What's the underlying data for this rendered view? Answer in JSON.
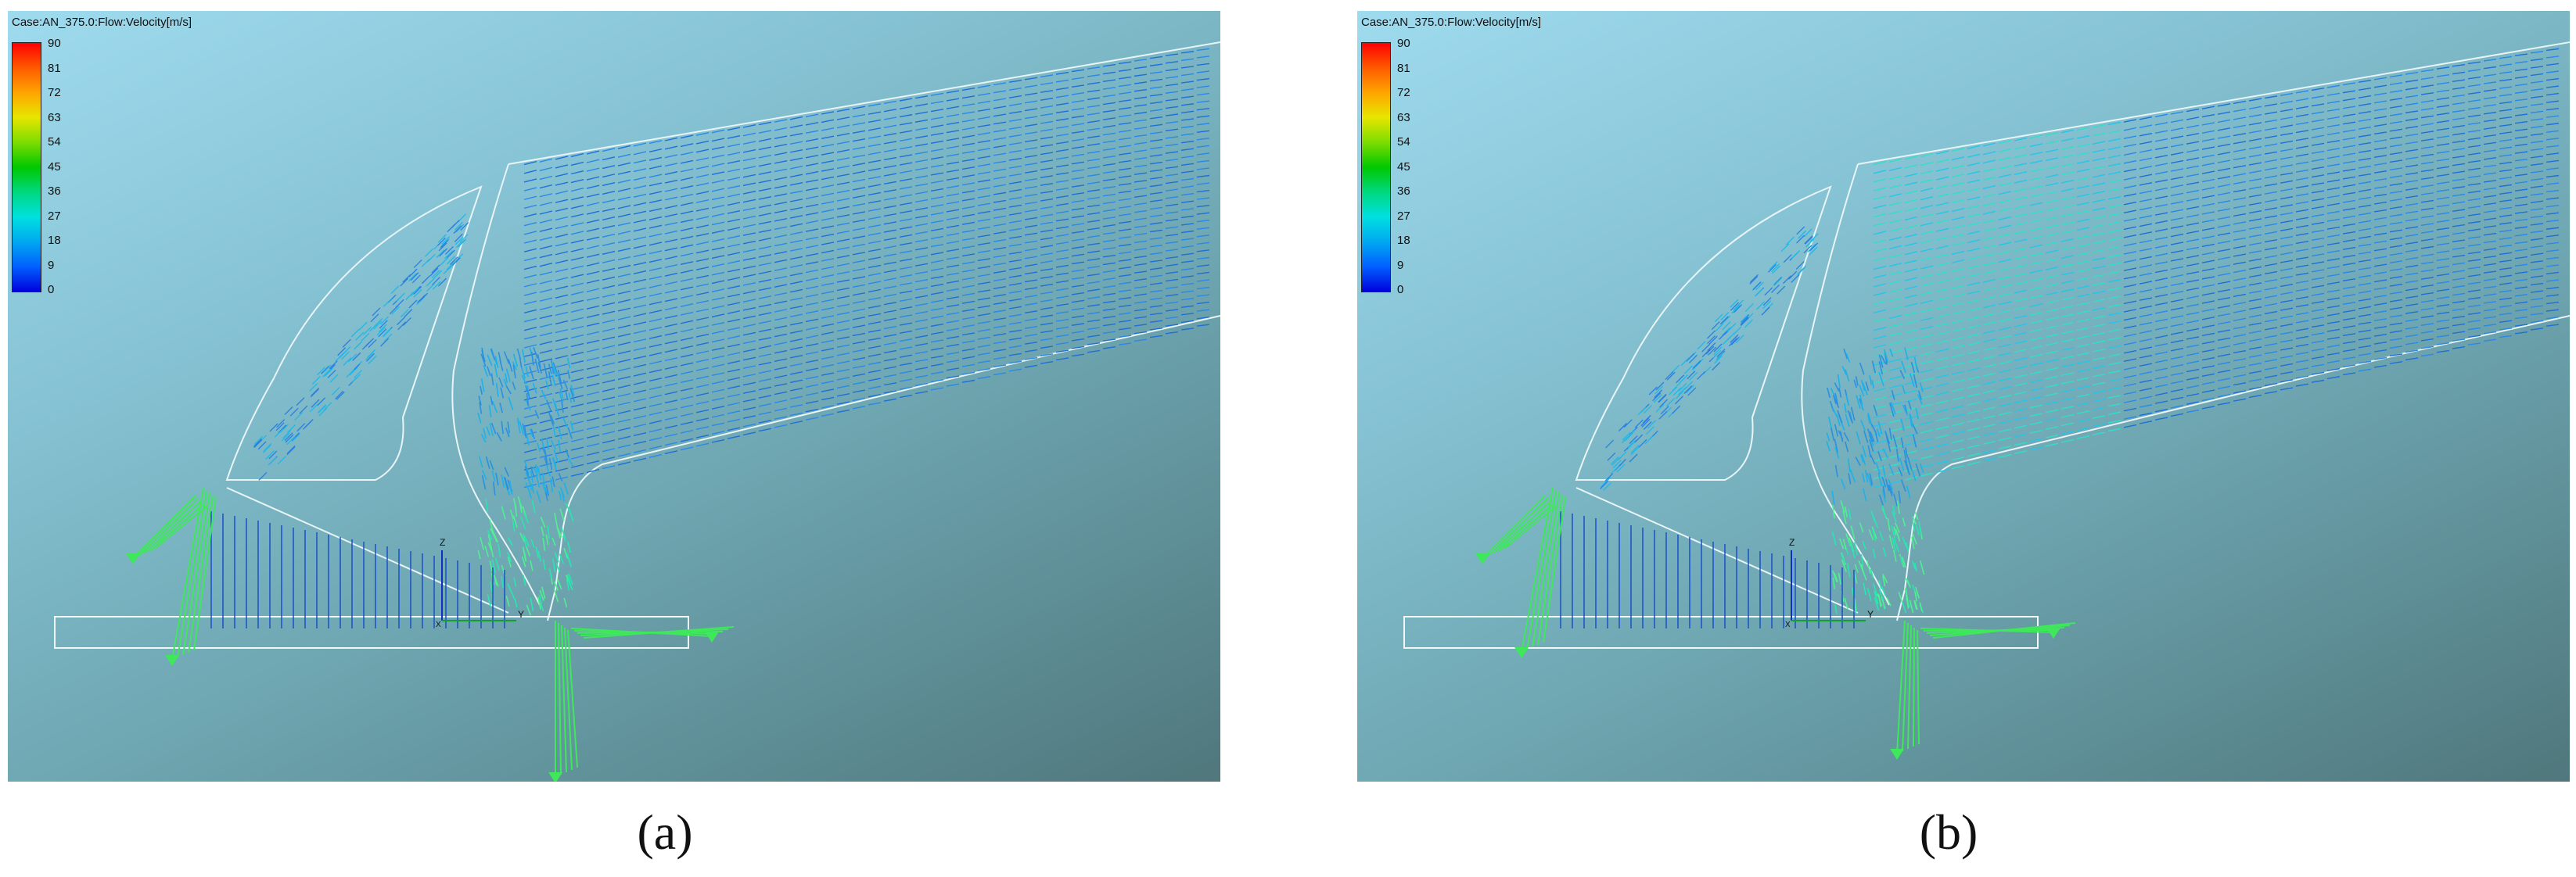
{
  "figure": {
    "panels": [
      {
        "id": "a",
        "case_label": "Case:AN_375.0:Flow:Velocity[m/s]",
        "caption": "(a)"
      },
      {
        "id": "b",
        "case_label": "Case:AN_375.0:Flow:Velocity[m/s]",
        "caption": "(b)"
      }
    ],
    "legend": {
      "ticks": [
        "90",
        "81",
        "72",
        "63",
        "54",
        "45",
        "36",
        "27",
        "18",
        "9",
        "0"
      ],
      "colors": [
        "#ff0000",
        "#ff5a00",
        "#ffa500",
        "#e6e600",
        "#7ddc00",
        "#00c800",
        "#00d880",
        "#00e0e0",
        "#00a8f0",
        "#0060ff",
        "#0000e0"
      ]
    },
    "axis_triad": {
      "z": "Z",
      "x": "X",
      "y": "Y"
    }
  }
}
